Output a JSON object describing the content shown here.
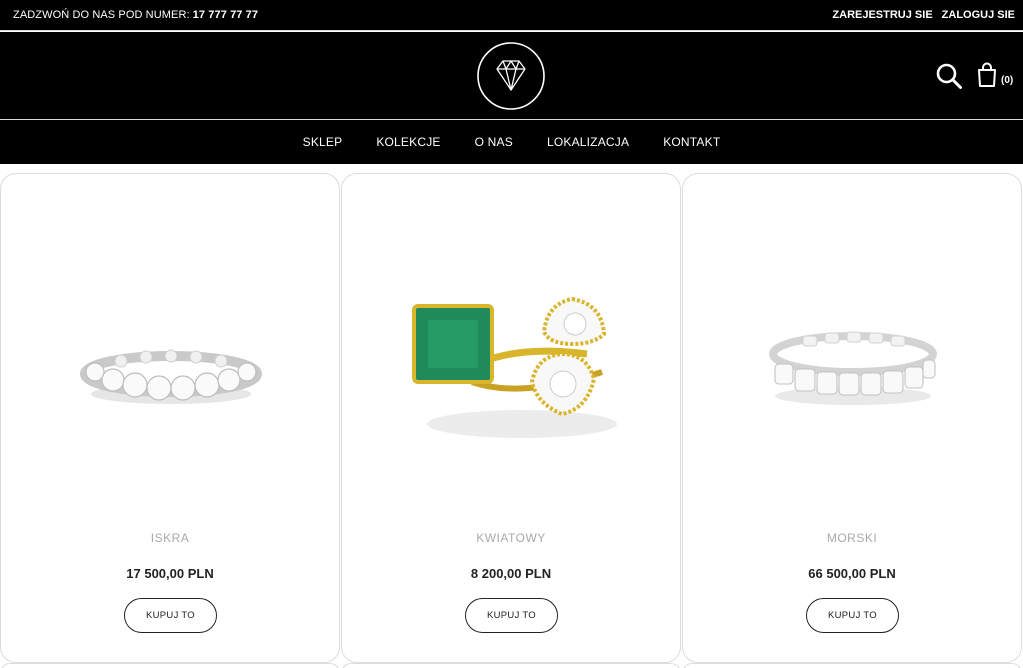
{
  "topbar": {
    "phone_label": "ZADZWOŃ DO NAS POD NUMER:",
    "phone_number": "17 777 77 77",
    "register": "ZAREJESTRUJ SIE",
    "login": "ZALOGUJ SIE"
  },
  "header": {
    "cart_count": "(0)"
  },
  "nav": [
    "SKLEP",
    "KOLEKCJE",
    "O NAS",
    "LOKALIZACJA",
    "KONTAKT"
  ],
  "products": [
    {
      "name": "ISKRA",
      "price": "17 500,00 PLN",
      "button": "KUPUJ TO"
    },
    {
      "name": "KWIATOWY",
      "price": "8 200,00 PLN",
      "button": "KUPUJ TO"
    },
    {
      "name": "MORSKI",
      "price": "66 500,00 PLN",
      "button": "KUPUJ TO"
    }
  ],
  "colors": {
    "header_bg": "#000000",
    "text_light": "#ffffff",
    "product_name": "#a9a9a9",
    "emerald": "#1f8a5a",
    "gold": "#d9b52c"
  },
  "icons": [
    "diamond-logo-icon",
    "search-icon",
    "shopping-bag-icon"
  ]
}
